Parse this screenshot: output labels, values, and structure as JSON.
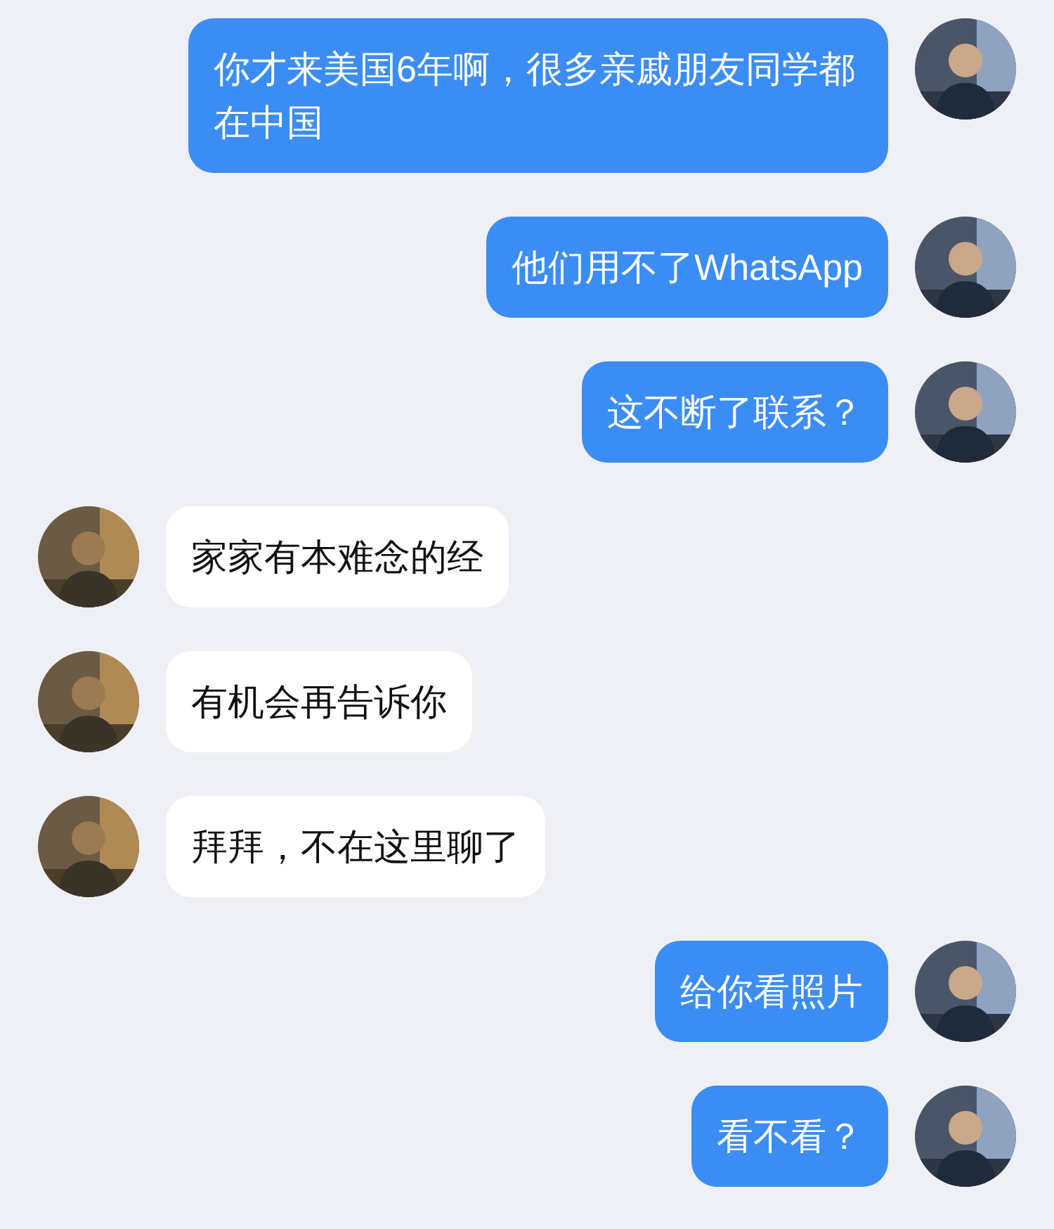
{
  "messages": [
    {
      "kind": "outgoing",
      "text": "你才来美国6年啊，很多亲戚朋友同学都在中国"
    },
    {
      "kind": "outgoing",
      "text": "他们用不了WhatsApp"
    },
    {
      "kind": "outgoing",
      "text": "这不断了联系？"
    },
    {
      "kind": "incoming",
      "text": "家家有本难念的经"
    },
    {
      "kind": "incoming",
      "text": "有机会再告诉你"
    },
    {
      "kind": "incoming",
      "text": "拜拜，不在这里聊了"
    },
    {
      "kind": "outgoing",
      "text": "给你看照片"
    },
    {
      "kind": "outgoing",
      "text": "看不看？"
    }
  ]
}
